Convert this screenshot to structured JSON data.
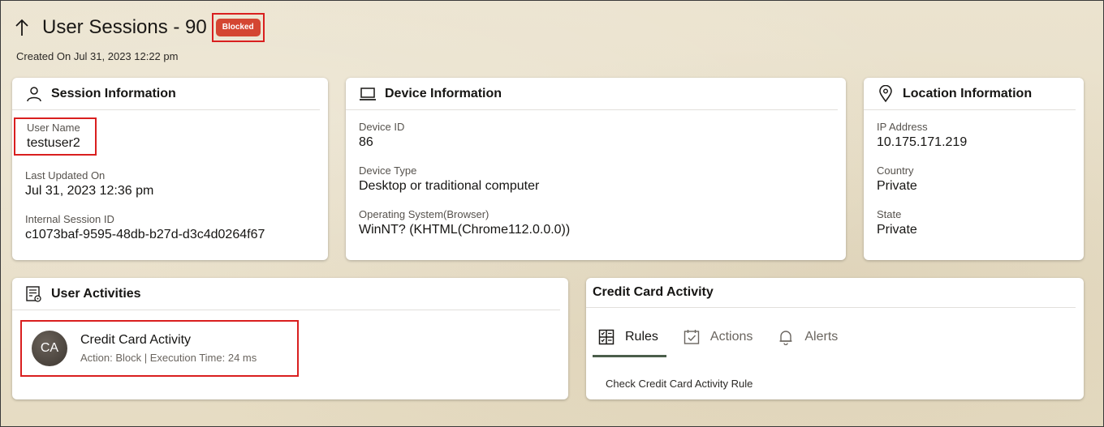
{
  "header": {
    "title": "User Sessions - 90",
    "status_badge": "Blocked",
    "created": "Created On Jul 31, 2023 12:22 pm"
  },
  "session_info": {
    "title": "Session Information",
    "icon": "person-icon",
    "fields": [
      {
        "label": "User Name",
        "value": "testuser2"
      },
      {
        "label": "Last Updated On",
        "value": "Jul 31, 2023 12:36 pm"
      },
      {
        "label": "Internal Session ID",
        "value": "c1073baf-9595-48db-b27d-d3c4d0264f67"
      }
    ]
  },
  "device_info": {
    "title": "Device Information",
    "icon": "laptop-icon",
    "fields": [
      {
        "label": "Device ID",
        "value": "86"
      },
      {
        "label": "Device Type",
        "value": "Desktop or traditional computer"
      },
      {
        "label": "Operating System(Browser)",
        "value": "WinNT? (KHTML(Chrome112.0.0.0))"
      }
    ]
  },
  "location_info": {
    "title": "Location Information",
    "icon": "map-pin-icon",
    "fields": [
      {
        "label": "IP Address",
        "value": "10.175.171.219"
      },
      {
        "label": "Country",
        "value": "Private"
      },
      {
        "label": "State",
        "value": "Private"
      }
    ]
  },
  "user_activities": {
    "title": "User Activities",
    "icon": "activity-list-icon",
    "items": [
      {
        "initials": "CA",
        "name": "Credit Card Activity",
        "detail": "Action: Block | Execution Time: 24 ms"
      }
    ]
  },
  "credit_card_activity": {
    "title": "Credit Card Activity",
    "tabs": [
      {
        "label": "Rules",
        "icon": "rules-grid-icon",
        "active": true
      },
      {
        "label": "Actions",
        "icon": "calendar-check-icon",
        "active": false
      },
      {
        "label": "Alerts",
        "icon": "bell-icon",
        "active": false
      }
    ],
    "rule": "Check Credit Card Activity Rule"
  },
  "colors": {
    "badge": "#d44632",
    "highlight_border": "#d91f1f",
    "active_tab_underline": "#4b5e4b"
  }
}
